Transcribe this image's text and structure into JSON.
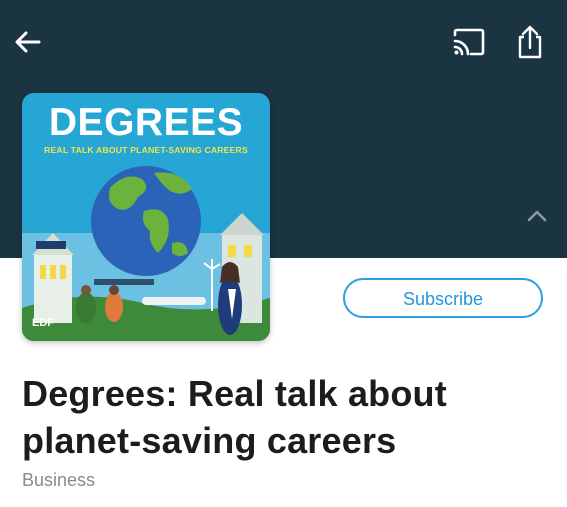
{
  "header": {
    "background_color": "#1b3442",
    "icons": [
      "back-arrow-icon",
      "cast-icon",
      "share-icon",
      "chevron-up-icon"
    ]
  },
  "artwork": {
    "title": "DEGREES",
    "subtitle": "REAL TALK ABOUT PLANET-SAVING CAREERS",
    "logo_text": "EDF"
  },
  "subscribe": {
    "label": "Subscribe",
    "accent_color": "#2d9ee0"
  },
  "podcast": {
    "title": "Degrees: Real talk about planet-saving careers",
    "category": "Business"
  }
}
